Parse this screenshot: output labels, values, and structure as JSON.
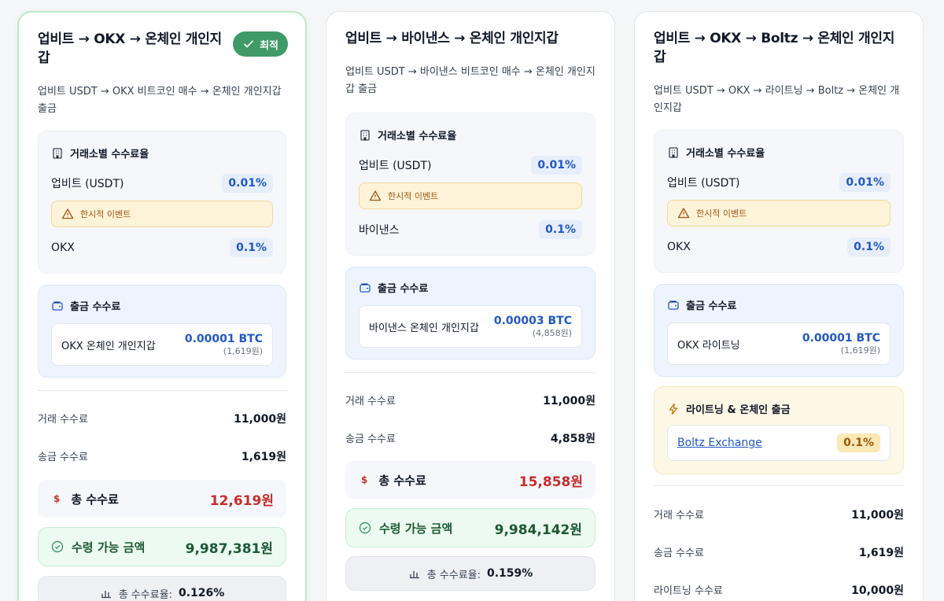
{
  "routes": [
    {
      "title": "업비트 → OKX → 온체인 개인지갑",
      "badge": "최적",
      "desc": "업비트 USDT → OKX 비트코인 매수 → 온체인 개인지갑 출금",
      "fee_rates_title": "거래소별 수수료율",
      "ex1_name": "업비트 (USDT)",
      "ex1_rate": "0.01%",
      "event": "한시적 이벤트",
      "ex2_name": "OKX",
      "ex2_rate": "0.1%",
      "withdraw_title": "출금 수수료",
      "withdraw_name": "OKX 온체인 개인지갑",
      "withdraw_btc": "0.00001 BTC",
      "withdraw_krw": "(1,619원)",
      "trade_fee_label": "거래 수수료",
      "trade_fee": "11,000원",
      "send_fee_label": "송금 수수료",
      "send_fee": "1,619원",
      "total_label": "총 수수료",
      "total": "12,619원",
      "receive_label": "수령 가능 금액",
      "receive": "9,987,381원",
      "ratio_label": "총 수수료율:",
      "ratio": "0.126%"
    },
    {
      "title": "업비트 → 바이낸스 → 온체인 개인지갑",
      "desc": "업비트 USDT → 바이낸스 비트코인 매수 → 온체인 개인지갑 출금",
      "fee_rates_title": "거래소별 수수료율",
      "ex1_name": "업비트 (USDT)",
      "ex1_rate": "0.01%",
      "event": "한시적 이벤트",
      "ex2_name": "바이낸스",
      "ex2_rate": "0.1%",
      "withdraw_title": "출금 수수료",
      "withdraw_name": "바이낸스 온체인 개인지갑",
      "withdraw_btc": "0.00003 BTC",
      "withdraw_krw": "(4,858원)",
      "trade_fee_label": "거래 수수료",
      "trade_fee": "11,000원",
      "send_fee_label": "송금 수수료",
      "send_fee": "4,858원",
      "total_label": "총 수수료",
      "total": "15,858원",
      "receive_label": "수령 가능 금액",
      "receive": "9,984,142원",
      "ratio_label": "총 수수료율:",
      "ratio": "0.159%"
    },
    {
      "title": "업비트 → OKX → Boltz → 온체인 개인지갑",
      "desc": "업비트 USDT → OKX → 라이트닝 → Boltz → 온체인 개인지갑",
      "fee_rates_title": "거래소별 수수료율",
      "ex1_name": "업비트 (USDT)",
      "ex1_rate": "0.01%",
      "event": "한시적 이벤트",
      "ex2_name": "OKX",
      "ex2_rate": "0.1%",
      "withdraw_title": "출금 수수료",
      "withdraw_name": "OKX 라이트닝",
      "withdraw_btc": "0.00001 BTC",
      "withdraw_krw": "(1,619원)",
      "lightning_title": "라이트닝 & 온체인 출금",
      "lightning_name": "Boltz Exchange",
      "lightning_rate": "0.1%",
      "trade_fee_label": "거래 수수료",
      "trade_fee": "11,000원",
      "send_fee_label": "송금 수수료",
      "send_fee": "1,619원",
      "lightning_fee_label": "라이트닝 수수료",
      "lightning_fee": "10,000원"
    }
  ],
  "icons": {
    "check": "check-icon",
    "building": "building-icon",
    "warning": "warning-icon",
    "wallet": "wallet-icon",
    "dollar": "dollar-icon",
    "check_circle": "check-circle-icon",
    "bar_chart": "bar-chart-icon",
    "bolt": "lightning-icon"
  },
  "colors": {
    "best_badge": "#3f9a67",
    "rate_blue": "#2158c4",
    "total_red": "#c62d2d",
    "receive_green": "#1d5a35",
    "event_text": "#a35611"
  }
}
